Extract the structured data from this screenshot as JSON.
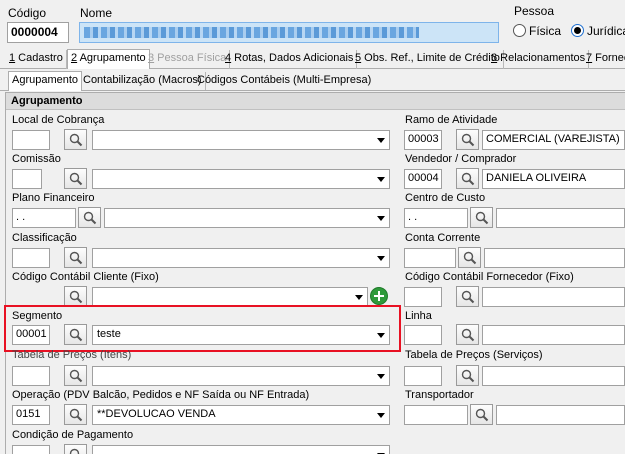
{
  "header": {
    "codigo_label": "Código",
    "codigo_value": "0000004",
    "nome_label": "Nome",
    "pessoa_label": "Pessoa",
    "pessoa_fisica": "Física",
    "pessoa_juridica": "Jurídica"
  },
  "tabs": [
    {
      "key": "1",
      "label": " Cadastro"
    },
    {
      "key": "2",
      "label": " Agrupamento"
    },
    {
      "key": "3",
      "label": " Pessoa Física"
    },
    {
      "key": "4",
      "label": " Rotas, Dados Adicionais"
    },
    {
      "key": "5",
      "label": " Obs. Ref., Limite de Crédito"
    },
    {
      "key": "6",
      "label": " Relacionamentos"
    },
    {
      "key": "7",
      "label": " Fornec"
    }
  ],
  "subtabs": [
    "Agrupamento",
    "Contabilização (Macros)",
    "Códigos Contábeis (Multi-Empresa)"
  ],
  "section_title": "Agrupamento",
  "left": {
    "local_cobranca": "Local de Cobrança",
    "comissao": "Comissão",
    "plano_financeiro": "Plano Financeiro",
    "plano_financeiro_value": " .  .",
    "classificacao": "Classificação",
    "codigo_contabil_cliente": "Código Contábil Cliente (Fixo)",
    "segmento": "Segmento",
    "segmento_code": "00001",
    "segmento_value": "teste",
    "tabela_precos_itens": "Tabela de Preços (Itens)",
    "operacao": "Operação (PDV Balcão, Pedidos e NF Saída ou NF Entrada)",
    "operacao_code": "0151",
    "operacao_value": "**DEVOLUCAO  VENDA",
    "condicao_pagamento": "Condição de Pagamento"
  },
  "right": {
    "ramo_atividade": "Ramo de Atividade",
    "ramo_code": "00003",
    "ramo_value": "COMERCIAL (VAREJISTA)",
    "vendedor": "Vendedor / Comprador",
    "vendedor_code": "00004",
    "vendedor_value": "DANIELA OLIVEIRA",
    "centro_custo": "Centro de Custo",
    "centro_custo_value": " .  .",
    "conta_corrente": "Conta Corrente",
    "codigo_contabil_fornecedor": "Código Contábil Fornecedor (Fixo)",
    "linha": "Linha",
    "tabela_precos_servicos": "Tabela de Preços (Serviços)",
    "transportador": "Transportador"
  },
  "colors": {
    "highlight_border": "#e81123",
    "name_field": "#cce4f7",
    "section_bg": "#dcdcdc",
    "add_button": "#2e9a3a"
  }
}
